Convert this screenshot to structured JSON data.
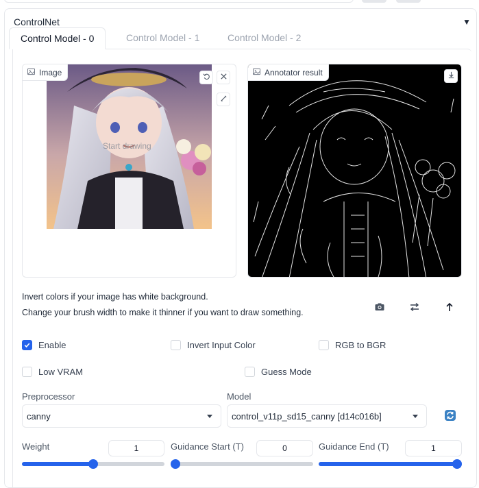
{
  "panel": {
    "title": "ControlNet",
    "collapse_icon": "triangle-down-icon"
  },
  "tabs": [
    {
      "label": "Control Model - 0",
      "active": true
    },
    {
      "label": "Control Model - 1",
      "active": false
    },
    {
      "label": "Control Model - 2",
      "active": false
    }
  ],
  "image_input": {
    "label": "Image",
    "overlay_text": "Start drawing"
  },
  "annotator": {
    "label": "Annotator result"
  },
  "hints": {
    "line1": "Invert colors if your image has white background.",
    "line2": "Change your brush width to make it thinner if you want to draw something."
  },
  "checkboxes": {
    "enable": {
      "label": "Enable",
      "checked": true
    },
    "invert_input_color": {
      "label": "Invert Input Color",
      "checked": false
    },
    "rgb_to_bgr": {
      "label": "RGB to BGR",
      "checked": false
    },
    "low_vram": {
      "label": "Low VRAM",
      "checked": false
    },
    "guess_mode": {
      "label": "Guess Mode",
      "checked": false
    }
  },
  "preprocessor": {
    "label": "Preprocessor",
    "value": "canny"
  },
  "model": {
    "label": "Model",
    "value": "control_v11p_sd15_canny [d14c016b]"
  },
  "sliders": {
    "weight": {
      "label": "Weight",
      "value": "1",
      "fraction": 0.5
    },
    "guidance_start": {
      "label": "Guidance Start (T)",
      "value": "0",
      "fraction": 0.0
    },
    "guidance_end": {
      "label": "Guidance End (T)",
      "value": "1",
      "fraction": 1.0
    }
  },
  "colors": {
    "accent": "#2563eb",
    "border": "#e5e7eb"
  }
}
